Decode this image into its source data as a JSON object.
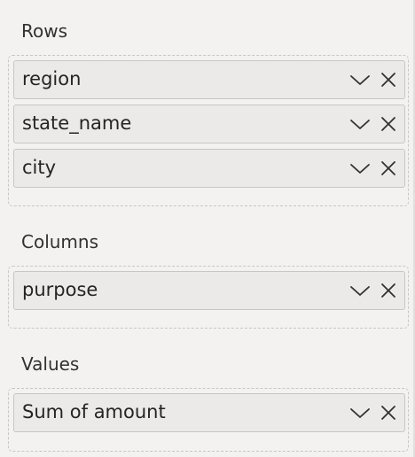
{
  "sections": {
    "rows": {
      "title": "Rows",
      "fields": [
        {
          "label": "region"
        },
        {
          "label": "state_name"
        },
        {
          "label": "city"
        }
      ]
    },
    "columns": {
      "title": "Columns",
      "fields": [
        {
          "label": "purpose"
        }
      ]
    },
    "values": {
      "title": "Values",
      "fields": [
        {
          "label": "Sum of amount"
        }
      ]
    }
  },
  "icons": {
    "expand": "chevron-down-icon",
    "remove": "close-icon"
  },
  "colors": {
    "pane_background": "#f3f2f1",
    "field_background": "#ebeae9",
    "field_border": "#c8c6c4",
    "text": "#252423"
  }
}
